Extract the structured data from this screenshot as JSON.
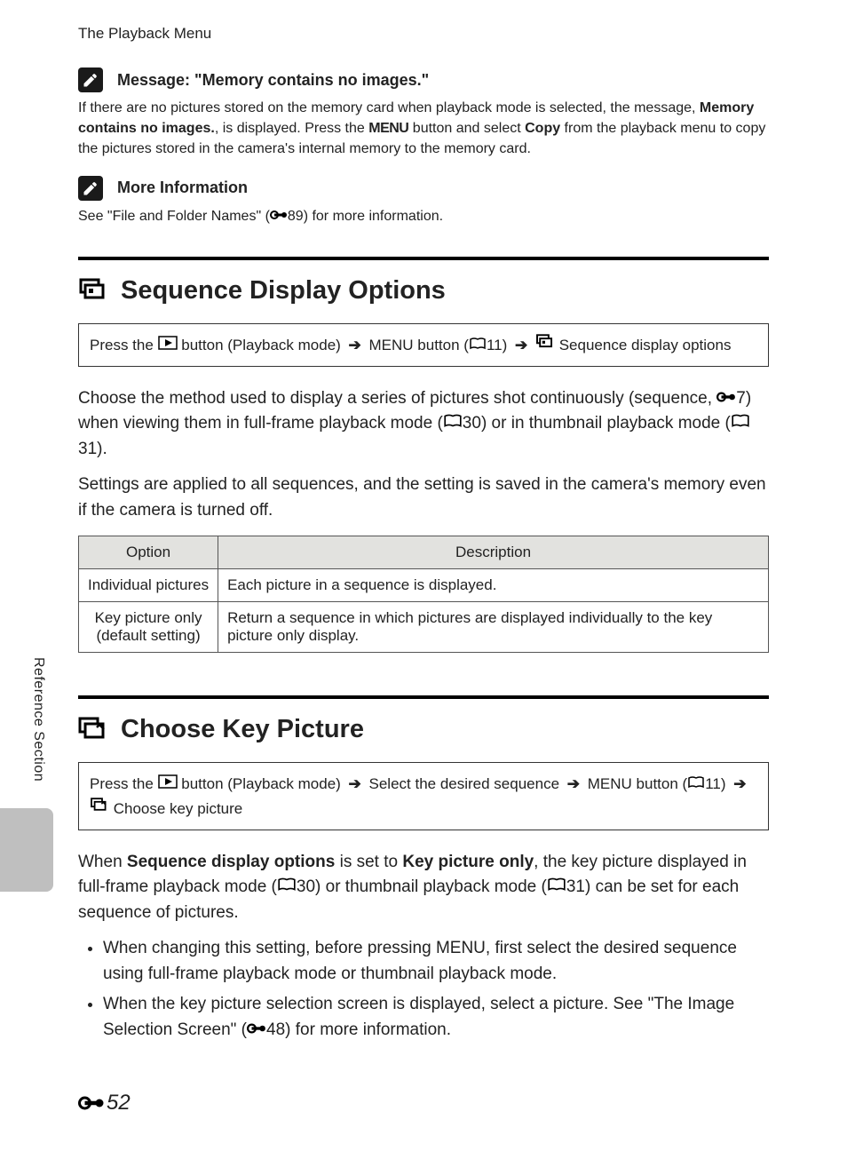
{
  "running_head": "The Playback Menu",
  "note1": {
    "title": "Message: \"Memory contains no images.\"",
    "body_pre": "If there are no pictures stored on the memory card when playback mode is selected, the message, ",
    "bold1": "Memory contains no images.",
    "body_mid1": ", is displayed. Press the ",
    "menu_word": "MENU",
    "body_mid2": " button and select ",
    "bold2": "Copy",
    "body_post": " from the playback menu to copy the pictures stored in the camera's internal memory to the memory card."
  },
  "note2": {
    "title": "More Information",
    "body_pre": "See \"File and Folder Names\" (",
    "ref": "89",
    "body_post": ") for more information."
  },
  "section1": {
    "title": "Sequence Display Options",
    "nav": {
      "t1": "Press the ",
      "t2": " button (Playback mode) ",
      "menu": "MENU",
      "t3": " button (",
      "ref": "11",
      "t4": ") ",
      "t5": " Sequence display options"
    },
    "para1": {
      "a": "Choose the method used to display a series of pictures shot continuously (sequence, ",
      "ref1": "7",
      "b": ") when viewing them in full-frame playback mode (",
      "ref2": "30",
      "c": ") or in thumbnail playback mode (",
      "ref3": "31",
      "d": ")."
    },
    "para2": "Settings are applied to all sequences, and the setting is saved in the camera's memory even if the camera is turned off.",
    "table": {
      "h1": "Option",
      "h2": "Description",
      "r1c1": "Individual pictures",
      "r1c2": "Each picture in a sequence is displayed.",
      "r2c1a": "Key picture only",
      "r2c1b": "(default setting)",
      "r2c2": "Return a sequence in which pictures are displayed individually to the key picture only display."
    }
  },
  "section2": {
    "title": "Choose Key Picture",
    "nav": {
      "t1": "Press the ",
      "t2": " button (Playback mode) ",
      "t3": " Select the desired sequence  ",
      "menu": "MENU",
      "t4": " button (",
      "ref": "11",
      "t5": ") ",
      "t6": " Choose key picture"
    },
    "para1": {
      "a": "When ",
      "b1": "Sequence display options",
      "b": " is set to ",
      "b2": "Key picture only",
      "c": ", the key picture displayed in full-frame playback mode (",
      "ref1": "30",
      "d": ") or thumbnail playback mode (",
      "ref2": "31",
      "e": ") can be set for each sequence of pictures."
    },
    "bullets": {
      "li1a": "When changing this setting, before pressing ",
      "li1menu": "MENU",
      "li1b": ", first select the desired sequence using full-frame playback mode or thumbnail playback mode.",
      "li2a": "When the key picture selection screen is displayed, select a picture. See \"The Image Selection Screen\" (",
      "li2ref": "48",
      "li2b": ") for more information."
    }
  },
  "side_tab": "Reference Section",
  "page_number": "52"
}
